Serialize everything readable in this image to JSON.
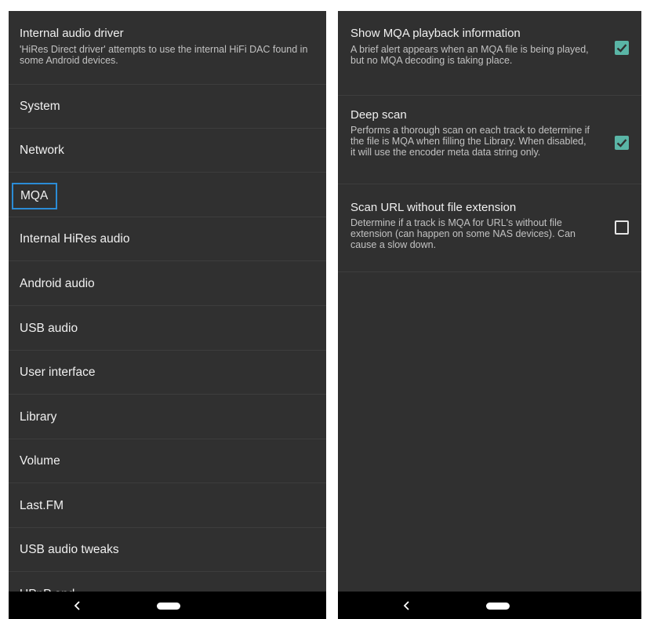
{
  "left_pane": {
    "driver": {
      "title": "Internal audio driver",
      "description": "'HiRes Direct driver' attempts to use the internal HiFi DAC found in some Android devices."
    },
    "menu_items": [
      {
        "label": "System"
      },
      {
        "label": "Network"
      },
      {
        "label": "MQA",
        "focused": true
      },
      {
        "label": "Internal HiRes audio"
      },
      {
        "label": "Android audio"
      },
      {
        "label": "USB audio"
      },
      {
        "label": "User interface"
      },
      {
        "label": "Library"
      },
      {
        "label": "Volume"
      },
      {
        "label": "Last.FM"
      },
      {
        "label": "USB audio tweaks"
      },
      {
        "label": "UPnP and..."
      }
    ]
  },
  "right_pane": {
    "settings": [
      {
        "title": "Show MQA playback information",
        "description": "A brief alert appears when an MQA file is being played, but no MQA decoding is taking place.",
        "checked": true
      },
      {
        "title": "Deep scan",
        "description": "Performs a thorough scan on each track to determine if the file is MQA when filling the Library. When disabled, it will use the encoder meta data string only.",
        "checked": true
      },
      {
        "title": "Scan URL without file extension",
        "description": "Determine if a track is MQA for URL's without file extension (can happen on some NAS devices). Can cause a slow down.",
        "checked": false
      }
    ]
  },
  "nav_bar": {
    "icons": [
      "back-icon",
      "home-pill-icon"
    ]
  },
  "colors": {
    "background": "#303030",
    "divider": "#3d3d3d",
    "focus_outline": "#2b8cd6",
    "checkbox_checked": "#5ab5a6",
    "nav_bar": "#000000"
  }
}
